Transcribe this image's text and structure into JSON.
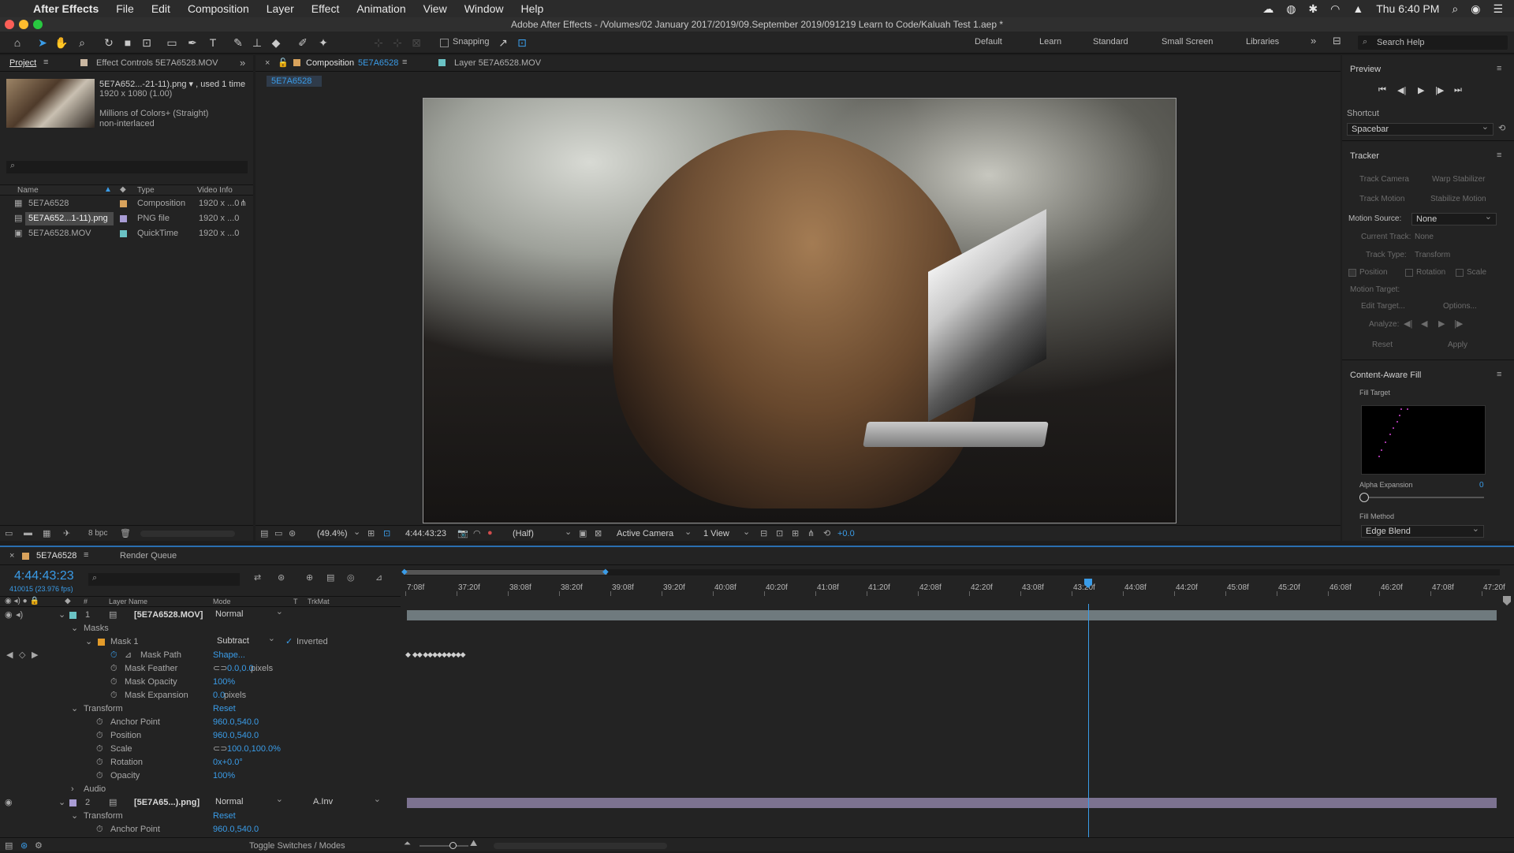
{
  "menubar": {
    "app": "After Effects",
    "items": [
      "File",
      "Edit",
      "Composition",
      "Layer",
      "Effect",
      "Animation",
      "View",
      "Window",
      "Help"
    ],
    "clock": "Thu 6:40 PM"
  },
  "window": {
    "title": "Adobe After Effects - /Volumes/02 January 2017/2019/09.September 2019/091219 Learn to Code/Kaluah Test 1.aep *"
  },
  "toolbar": {
    "snapping_label": "Snapping",
    "workspaces": [
      "Default",
      "Learn",
      "Standard",
      "Small Screen",
      "Libraries"
    ],
    "search_placeholder": "Search Help"
  },
  "project_panel": {
    "tab_project": "Project",
    "tab_effect_controls": "Effect Controls 5E7A6528.MOV",
    "selected_name": "5E7A652...-21-11).png ▾ , used 1 time",
    "selected_dims": "1920 x 1080 (1.00)",
    "selected_colors": "Millions of Colors+ (Straight)",
    "selected_interlace": "non-interlaced",
    "columns": {
      "name": "Name",
      "type": "Type",
      "video": "Video Info"
    },
    "items": [
      {
        "name": "5E7A6528",
        "type": "Composition",
        "video": "1920 x ...0",
        "color": "#d8a25c"
      },
      {
        "name": "5E7A652...1-11).png",
        "type": "PNG file",
        "video": "1920 x ...0",
        "color": "#a89cd4"
      },
      {
        "name": "5E7A6528.MOV",
        "type": "QuickTime",
        "video": "1920 x ...0",
        "color": "#6ac2c4"
      }
    ],
    "bpc": "8 bpc"
  },
  "comp_panel": {
    "tab_comp": "Composition",
    "tab_comp_name": "5E7A6528",
    "tab_layer": "Layer 5E7A6528.MOV",
    "flowchart": "5E7A6528",
    "zoom": "(49.4%)",
    "timecode": "4:44:43:23",
    "resolution": "(Half)",
    "camera": "Active Camera",
    "view": "1 View",
    "exposure": "+0.0"
  },
  "preview_panel": {
    "title": "Preview",
    "shortcut_label": "Shortcut",
    "shortcut_value": "Spacebar"
  },
  "tracker_panel": {
    "title": "Tracker",
    "track_camera": "Track Camera",
    "warp_stabilizer": "Warp Stabilizer",
    "track_motion": "Track Motion",
    "stabilize_motion": "Stabilize Motion",
    "motion_source_label": "Motion Source:",
    "motion_source_value": "None",
    "current_track_label": "Current Track:",
    "current_track_value": "None",
    "track_type_label": "Track Type:",
    "track_type_value": "Transform",
    "position": "Position",
    "rotation": "Rotation",
    "scale": "Scale",
    "motion_target": "Motion Target:",
    "edit_target": "Edit Target...",
    "options": "Options...",
    "analyze": "Analyze:",
    "reset": "Reset",
    "apply": "Apply"
  },
  "caf_panel": {
    "title": "Content-Aware Fill",
    "fill_target": "Fill Target",
    "alpha_expansion_label": "Alpha Expansion",
    "alpha_expansion_value": "0",
    "fill_method_label": "Fill Method",
    "fill_method_value": "Edge Blend"
  },
  "timeline": {
    "tab_comp": "5E7A6528",
    "tab_render": "Render Queue",
    "timecode": "4:44:43:23",
    "frame_info": "410015 (23.976 fps)",
    "columns": {
      "num": "#",
      "layer_name": "Layer Name",
      "mode": "Mode",
      "t": "T",
      "trkmat": "TrkMat"
    },
    "ruler": [
      "7:08f",
      "37:20f",
      "38:08f",
      "38:20f",
      "39:08f",
      "39:20f",
      "40:08f",
      "40:20f",
      "41:08f",
      "41:20f",
      "42:08f",
      "42:20f",
      "43:08f",
      "43:20f",
      "44:08f",
      "44:20f",
      "45:08f",
      "45:20f",
      "46:08f",
      "46:20f",
      "47:08f",
      "47:20f"
    ],
    "layer1": {
      "num": "1",
      "name": "[5E7A6528.MOV]",
      "mode": "Normal"
    },
    "masks": "Masks",
    "mask1": {
      "name": "Mask 1",
      "mode": "Subtract",
      "inverted": "Inverted"
    },
    "mask_props": [
      {
        "name": "Mask Path",
        "value": "Shape..."
      },
      {
        "name": "Mask Feather",
        "value": "0.0,0.0",
        "unit": " pixels"
      },
      {
        "name": "Mask Opacity",
        "value": "100%",
        "unit": ""
      },
      {
        "name": "Mask Expansion",
        "value": "0.0",
        "unit": " pixels"
      }
    ],
    "transform": "Transform",
    "reset": "Reset",
    "transform_props": [
      {
        "name": "Anchor Point",
        "value": "960.0,540.0"
      },
      {
        "name": "Position",
        "value": "960.0,540.0"
      },
      {
        "name": "Scale",
        "value": "100.0,100.0%"
      },
      {
        "name": "Rotation",
        "value": "0x+0.0°"
      },
      {
        "name": "Opacity",
        "value": "100%"
      }
    ],
    "audio": "Audio",
    "layer2": {
      "num": "2",
      "name": "[5E7A65...).png]",
      "mode": "Normal",
      "trkmat": "A.Inv"
    },
    "layer2_anchor": {
      "name": "Anchor Point",
      "value": "960.0,540.0"
    },
    "toggle": "Toggle Switches / Modes"
  }
}
